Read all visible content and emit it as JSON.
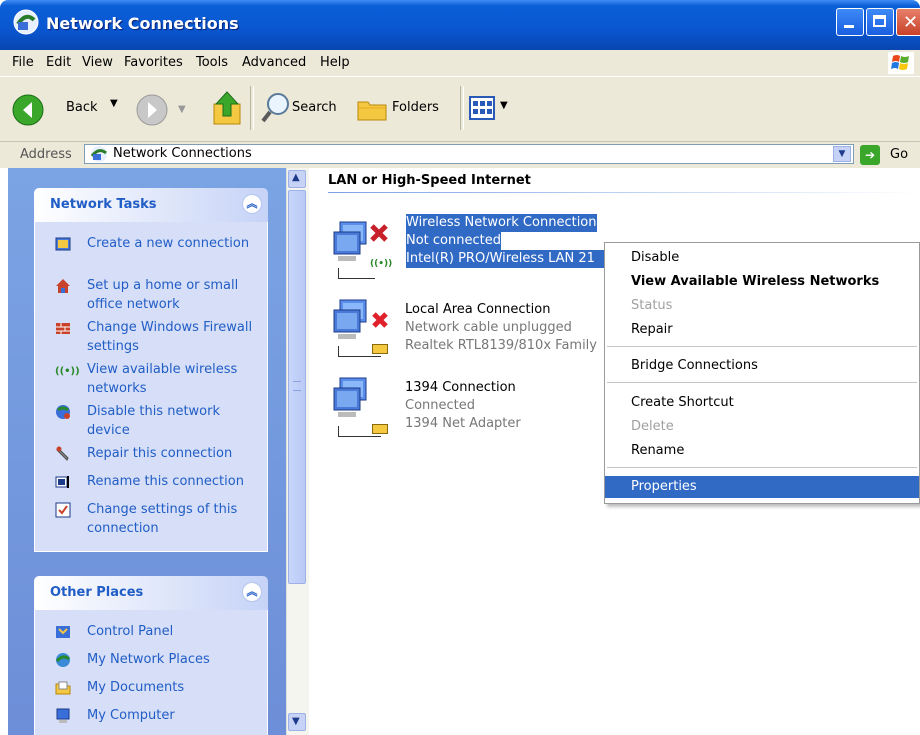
{
  "window": {
    "title": "Network Connections"
  },
  "menu": [
    "File",
    "Edit",
    "View",
    "Favorites",
    "Tools",
    "Advanced",
    "Help"
  ],
  "toolbar": {
    "back": "Back",
    "search": "Search",
    "folders": "Folders"
  },
  "address": {
    "label": "Address",
    "value": "Network Connections",
    "go": "Go"
  },
  "network_tasks": {
    "title": "Network Tasks",
    "items": [
      "Create a new connection",
      "Set up a home or small office network",
      "Change Windows Firewall settings",
      "View available wireless networks",
      "Disable this network device",
      "Repair this connection",
      "Rename this connection",
      "Change settings of this connection"
    ]
  },
  "other_places": {
    "title": "Other Places",
    "items": [
      "Control Panel",
      "My Network Places",
      "My Documents",
      "My Computer"
    ]
  },
  "group": {
    "title": "LAN or High-Speed Internet"
  },
  "connections": [
    {
      "name": "Wireless Network Connection",
      "status": "Not connected",
      "device": "Intel(R) PRO/Wireless LAN 21"
    },
    {
      "name": "Local Area Connection",
      "status": "Network cable unplugged",
      "device": "Realtek RTL8139/810x Family"
    },
    {
      "name": "1394 Connection",
      "status": "Connected",
      "device": "1394 Net Adapter"
    }
  ],
  "context_menu": {
    "items": [
      "Disable",
      "View Available Wireless Networks",
      "Status",
      "Repair",
      "Bridge Connections",
      "Create Shortcut",
      "Delete",
      "Rename",
      "Properties"
    ]
  },
  "colors": {
    "selection": "#316ac5",
    "titlebar": "#0a56d0",
    "link": "#215dc6",
    "panel": "#d6dff7"
  }
}
